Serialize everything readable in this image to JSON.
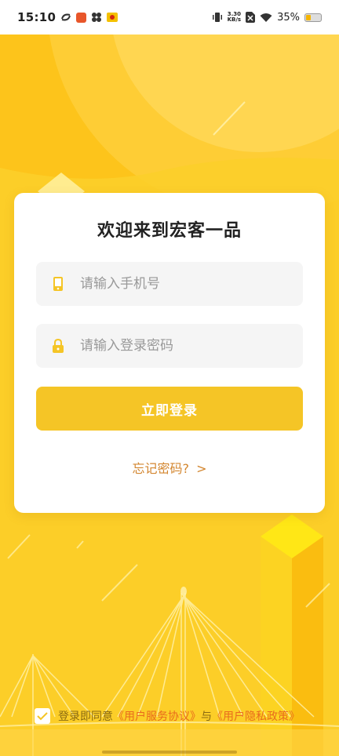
{
  "status_bar": {
    "time": "15:10",
    "net_speed_value": "3.30",
    "net_speed_unit": "KB/s",
    "battery_percent": "35%",
    "battery_level": 0.35,
    "notification_icons": [
      "sync-icon",
      "app-badge-icon",
      "weibo-icon",
      "gallery-icon"
    ]
  },
  "login": {
    "title": "欢迎来到宏客一品",
    "phone_placeholder": "请输入手机号",
    "password_placeholder": "请输入登录密码",
    "submit_label": "立即登录",
    "forgot_label": "忘记密码?",
    "forgot_chevron": ">"
  },
  "agreement": {
    "prefix": "登录即同意",
    "terms_link": "《用户服务协议》",
    "conjunction": "与",
    "privacy_link": "《用户隐私政策》",
    "checked": true
  },
  "colors": {
    "background": "#fdc41b",
    "button": "#f5c526",
    "link": "#e96b1d",
    "forgot": "#d3862f"
  }
}
